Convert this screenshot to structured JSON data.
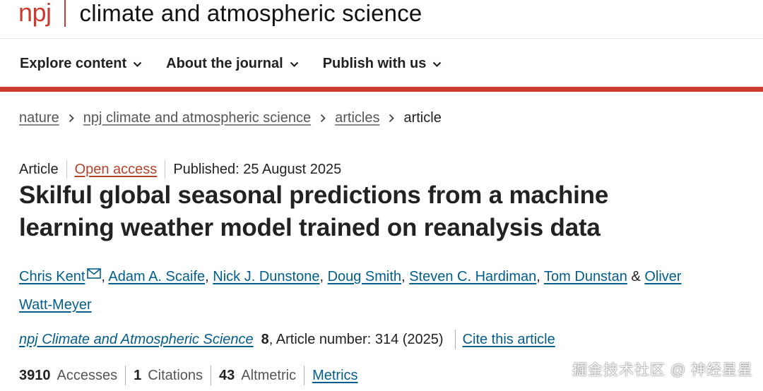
{
  "header": {
    "brand_short": "npj",
    "brand_title": "climate and atmospheric science",
    "brand_color": "#cc3b2f"
  },
  "nav": {
    "items": [
      {
        "label": "Explore content",
        "icon": "chevron-down-icon"
      },
      {
        "label": "About the journal",
        "icon": "chevron-down-icon"
      },
      {
        "label": "Publish with us",
        "icon": "chevron-down-icon"
      }
    ]
  },
  "breadcrumb": {
    "items": [
      "nature",
      "npj climate and atmospheric science",
      "articles"
    ],
    "current": "article"
  },
  "article": {
    "type": "Article",
    "access": "Open access",
    "published": "Published: 25 August 2025",
    "title": "Skilful global seasonal predictions from a machine learning weather model trained on reanalysis data",
    "authors": [
      "Chris Kent",
      "Adam A. Scaife",
      "Nick J. Dunstone",
      "Doug Smith",
      "Steven C. Hardiman",
      "Tom Dunstan",
      "Oliver Watt-Meyer"
    ],
    "author_sep": ",",
    "author_and": "&",
    "journal": "npj Climate and Atmospheric Science",
    "volume": "8",
    "article_number": ", Article number: 314 (2025)",
    "cite_label": "Cite this article"
  },
  "metrics": {
    "accesses_value": "3910",
    "accesses_label": "Accesses",
    "citations_value": "1",
    "citations_label": "Citations",
    "altmetric_value": "43",
    "altmetric_label": "Altmetric",
    "metrics_link": "Metrics"
  },
  "watermark": "掘金技术社区 @ 神经星星",
  "colors": {
    "link": "#025e8d",
    "accent_red": "#cc3b2f",
    "open_access": "#b5432b"
  }
}
